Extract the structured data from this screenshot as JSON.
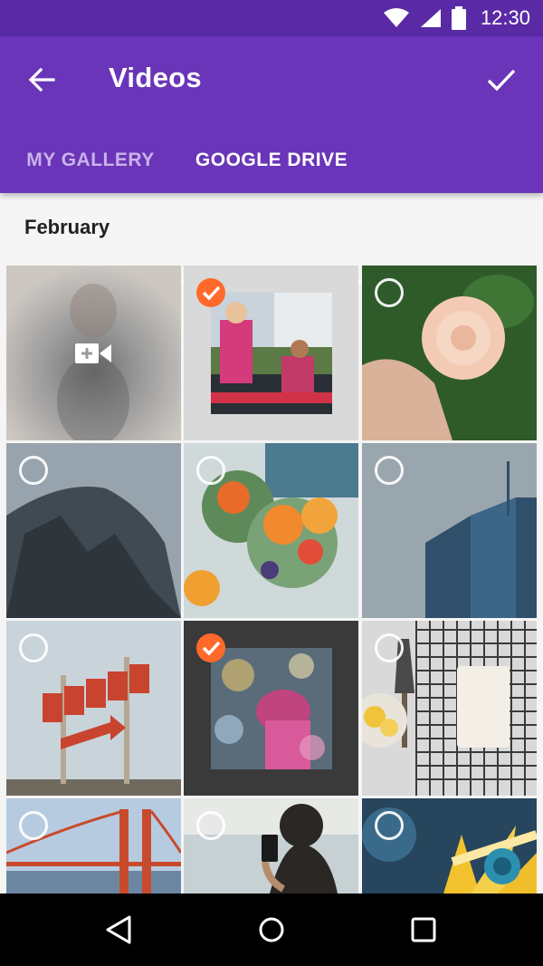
{
  "status_bar": {
    "time": "12:30",
    "icons": [
      "wifi-icon",
      "signal-icon",
      "battery-icon"
    ]
  },
  "app_bar": {
    "title": "Videos",
    "back_icon": "arrow-back-icon",
    "confirm_icon": "check-icon",
    "background": "#6a35b8"
  },
  "tabs": [
    {
      "label": "MY GALLERY",
      "selected": false
    },
    {
      "label": "GOOGLE DRIVE",
      "selected": true
    }
  ],
  "section": {
    "title": "February"
  },
  "grid": {
    "items": [
      {
        "kind": "add-video",
        "icon": "add-video-icon"
      },
      {
        "kind": "video",
        "subject": "musicians",
        "selected": true
      },
      {
        "kind": "image",
        "subject": "rose",
        "selected": false
      },
      {
        "kind": "image",
        "subject": "cliff",
        "selected": false
      },
      {
        "kind": "image",
        "subject": "smoothie",
        "selected": false
      },
      {
        "kind": "image",
        "subject": "skyscraper",
        "selected": false
      },
      {
        "kind": "image",
        "subject": "motel-sign",
        "selected": false
      },
      {
        "kind": "video",
        "subject": "city-lights",
        "selected": true
      },
      {
        "kind": "image",
        "subject": "pastry",
        "selected": false
      },
      {
        "kind": "image",
        "subject": "bridge",
        "selected": false
      },
      {
        "kind": "image",
        "subject": "phone-photo",
        "selected": false
      },
      {
        "kind": "image",
        "subject": "flower",
        "selected": false
      }
    ]
  },
  "colors": {
    "accent": "#ff6a2a",
    "primary": "#6a35b8",
    "primary_dark": "#5a2aa6"
  },
  "nav_bar": {
    "buttons": [
      "back-triangle-icon",
      "home-circle-icon",
      "recents-square-icon"
    ]
  }
}
